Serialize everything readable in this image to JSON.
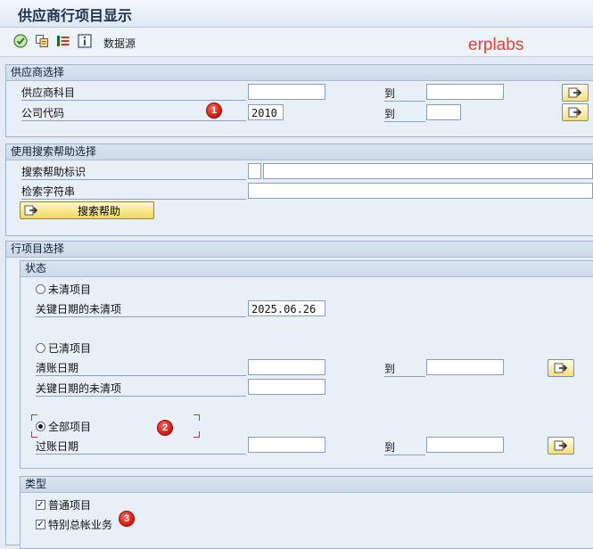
{
  "header": {
    "title": "供应商行项目显示"
  },
  "toolbar": {
    "icons": [
      "execute-icon",
      "copy-selections-icon",
      "dynamic-selections-icon",
      "info-icon"
    ],
    "datasource_label": "数据源"
  },
  "watermark": "erplabs",
  "vendor_selection": {
    "title": "供应商选择",
    "vendor_account_label": "供应商科目",
    "vendor_account_from": "",
    "vendor_account_to": "",
    "company_code_label": "公司代码",
    "company_code_from": "2010",
    "company_code_to": "",
    "to_label": "到"
  },
  "search_help_selection": {
    "title": "使用搜索帮助选择",
    "search_help_id_label": "搜索帮助标识",
    "search_help_id_value": "",
    "search_string_label": "检索字符串",
    "search_string_value": "",
    "search_help_button": "搜索帮助"
  },
  "line_item_selection": {
    "title": "行项目选择",
    "status": {
      "title": "状态",
      "open_items_label": "未清项目",
      "open_key_date_label": "关键日期的未清项",
      "open_key_date_value": "2025.06.26",
      "cleared_items_label": "已清项目",
      "clearing_date_label": "清账日期",
      "clearing_date_from": "",
      "clearing_date_to": "",
      "cleared_key_date_label": "关键日期的未清项",
      "cleared_key_date_value": "",
      "all_items_label": "全部项目",
      "posting_date_label": "过账日期",
      "posting_date_from": "",
      "posting_date_to": "",
      "to_label": "到",
      "selected": "all_items"
    },
    "type": {
      "title": "类型",
      "normal_items_label": "普通项目",
      "normal_items_checked": true,
      "special_gl_label": "特别总帐业务",
      "special_gl_checked": true
    }
  },
  "annotations": [
    "1",
    "2",
    "3"
  ],
  "colors": {
    "annotation_red": "#d4140a",
    "group_header": "#ccd9e9",
    "background": "#e4ebf5"
  }
}
